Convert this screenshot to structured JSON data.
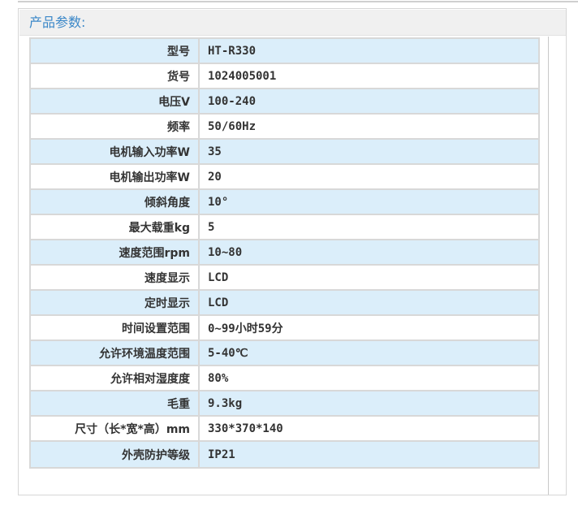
{
  "panel": {
    "title": "产品参数:"
  },
  "params": [
    {
      "label": "型号",
      "value": "HT-R330"
    },
    {
      "label": "货号",
      "value": "1024005001"
    },
    {
      "label": "电压V",
      "value": "100-240"
    },
    {
      "label": "频率",
      "value": "50/60Hz"
    },
    {
      "label": "电机输入功率W",
      "value": "35"
    },
    {
      "label": "电机输出功率W",
      "value": "20"
    },
    {
      "label": "倾斜角度",
      "value": "10°"
    },
    {
      "label": "最大载重kg",
      "value": "5"
    },
    {
      "label": "速度范围rpm",
      "value": "10~80"
    },
    {
      "label": "速度显示",
      "value": "LCD"
    },
    {
      "label": "定时显示",
      "value": "LCD"
    },
    {
      "label": "时间设置范围",
      "value": "0~99小时59分"
    },
    {
      "label": "允许环境温度范围",
      "value": "5-40℃"
    },
    {
      "label": "允许相对湿度度",
      "value": "80%"
    },
    {
      "label": "毛重",
      "value": "9.3kg"
    },
    {
      "label": "尺寸（长*宽*高）mm",
      "value": "330*370*140"
    },
    {
      "label": "外壳防护等级",
      "value": "IP21"
    }
  ],
  "colors": {
    "title": "#3a87c8",
    "row_alt": "#dbeefa",
    "row": "#ffffff",
    "border": "#d8d8d8"
  }
}
